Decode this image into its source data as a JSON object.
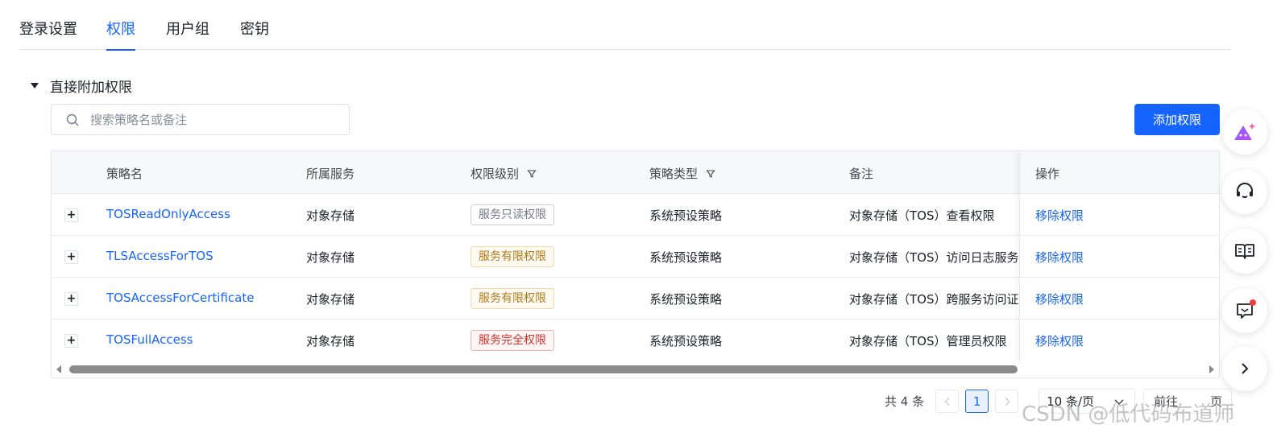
{
  "tabs": [
    {
      "label": "登录设置",
      "active": false
    },
    {
      "label": "权限",
      "active": true
    },
    {
      "label": "用户组",
      "active": false
    },
    {
      "label": "密钥",
      "active": false
    }
  ],
  "section": {
    "title": "直接附加权限"
  },
  "search": {
    "placeholder": "搜索策略名或备注"
  },
  "add_button": {
    "label": "添加权限"
  },
  "table": {
    "columns": {
      "name": "策略名",
      "service": "所属服务",
      "level": "权限级别",
      "type": "策略类型",
      "remark": "备注",
      "actions": "操作"
    },
    "rows": [
      {
        "name": "TOSReadOnlyAccess",
        "service": "对象存储",
        "level": "服务只读权限",
        "level_kind": "readonly",
        "type": "系统预设策略",
        "remark": "对象存储（TOS）查看权限",
        "action": "移除权限"
      },
      {
        "name": "TLSAccessForTOS",
        "service": "对象存储",
        "level": "服务有限权限",
        "level_kind": "limited",
        "type": "系统预设策略",
        "remark": "对象存储（TOS）访问日志服务",
        "action": "移除权限"
      },
      {
        "name": "TOSAccessForCertificate",
        "service": "对象存储",
        "level": "服务有限权限",
        "level_kind": "limited",
        "type": "系统预设策略",
        "remark": "对象存储（TOS）跨服务访问证书",
        "action": "移除权限"
      },
      {
        "name": "TOSFullAccess",
        "service": "对象存储",
        "level": "服务完全权限",
        "level_kind": "full",
        "type": "系统预设策略",
        "remark": "对象存储（TOS）管理员权限",
        "action": "移除权限"
      }
    ]
  },
  "pagination": {
    "total_text": "共 4 条",
    "current_page": "1",
    "page_size": "10 条/页",
    "goto_label": "前往",
    "goto_suffix": "页"
  },
  "watermark": "CSDN @低代码布道师",
  "colors": {
    "accent": "#1664ff",
    "limited": "#b07a18",
    "full": "#d7312a"
  },
  "float_toolbar": [
    "ai-assistant-icon",
    "customer-service-icon",
    "docs-book-icon",
    "feedback-message-icon",
    "expand-chevron-icon"
  ]
}
